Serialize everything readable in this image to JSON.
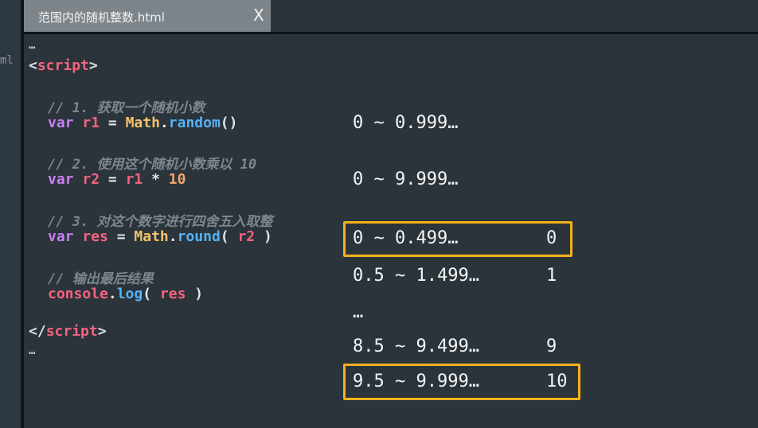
{
  "gutter": {
    "text": "ml"
  },
  "tab": {
    "title": "范围内的随机整数.html",
    "close_label": "X"
  },
  "code": {
    "ellipsis_top": "…",
    "open_tag_bracket": "<",
    "open_tag_name": "script",
    "open_tag_close": ">",
    "comment1": "// 1. 获取一个随机小数",
    "line1": {
      "kw": "var",
      "var": "r1",
      "eq": " = ",
      "cls": "Math",
      "dot": ".",
      "fn": "random",
      "rest": "()"
    },
    "comment2": "// 2. 使用这个随机小数乘以 10",
    "line2": {
      "kw": "var",
      "var": "r2",
      "eq": " = ",
      "ref": "r1",
      "op": " * ",
      "num": "10"
    },
    "comment3": "// 3. 对这个数字进行四舍五入取整",
    "line3": {
      "kw": "var",
      "var": "res",
      "eq": " = ",
      "cls": "Math",
      "dot": ".",
      "fn": "round",
      "open": "( ",
      "arg": "r2",
      "close": " )"
    },
    "comment4": "// 输出最后结果",
    "line4": {
      "obj": "console",
      "dot": ".",
      "fn": "log",
      "open": "( ",
      "arg": "res",
      "close": " )"
    },
    "close_tag_bracket": "</",
    "close_tag_name": "script",
    "close_tag_close": ">",
    "ellipsis_bottom": "…"
  },
  "annotations": {
    "r1_range": "0 ~ 0.999…",
    "r2_range": "0 ~ 9.999…",
    "map": [
      {
        "range": "0 ~ 0.499…",
        "result": "0",
        "highlighted": true
      },
      {
        "range": "0.5 ~ 1.499…",
        "result": "1",
        "highlighted": false
      },
      {
        "range": "…",
        "result": "",
        "highlighted": false
      },
      {
        "range": "8.5 ~ 9.499…",
        "result": "9",
        "highlighted": false
      },
      {
        "range": "9.5 ~ 9.999…",
        "result": "10",
        "highlighted": true
      }
    ]
  },
  "colors": {
    "background": "#2b343b",
    "tab": "#7d858b",
    "highlight_border": "#f2b21a",
    "keyword": "#c97ff0",
    "variable": "#f5637e",
    "class": "#f5c26b",
    "function": "#55b2f5",
    "number": "#f5a36b",
    "comment": "#7d868d"
  }
}
